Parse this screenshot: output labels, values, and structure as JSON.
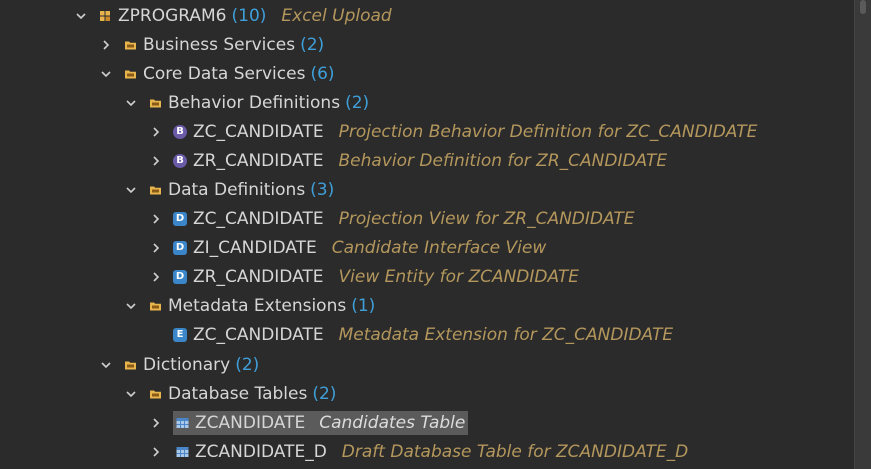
{
  "tree": {
    "rows": [
      {
        "name": "ZPROGRAM6",
        "count": "(10)",
        "desc": "Excel Upload",
        "icon": "package-icon",
        "expanded": true
      },
      {
        "name": "Business Services",
        "count": "(2)",
        "desc": "",
        "icon": "folder-icon",
        "expanded": false
      },
      {
        "name": "Core Data Services",
        "count": "(6)",
        "desc": "",
        "icon": "folder-icon",
        "expanded": true
      },
      {
        "name": "Behavior Definitions",
        "count": "(2)",
        "desc": "",
        "icon": "folder-icon",
        "expanded": true
      },
      {
        "name": "ZC_CANDIDATE",
        "count": "",
        "desc": "Projection Behavior Definition for ZC_CANDIDATE",
        "icon": "behavior-definition-icon",
        "icon_letter": "B",
        "expanded": false
      },
      {
        "name": "ZR_CANDIDATE",
        "count": "",
        "desc": "Behavior Definition for ZR_CANDIDATE",
        "icon": "behavior-definition-icon",
        "icon_letter": "B",
        "expanded": false
      },
      {
        "name": "Data Definitions",
        "count": "(3)",
        "desc": "",
        "icon": "folder-icon",
        "expanded": true
      },
      {
        "name": "ZC_CANDIDATE",
        "count": "",
        "desc": "Projection View for ZR_CANDIDATE",
        "icon": "data-definition-icon",
        "icon_letter": "D",
        "expanded": false
      },
      {
        "name": "ZI_CANDIDATE",
        "count": "",
        "desc": "Candidate Interface View",
        "icon": "data-definition-icon",
        "icon_letter": "D",
        "expanded": false
      },
      {
        "name": "ZR_CANDIDATE",
        "count": "",
        "desc": "View Entity for ZCANDIDATE",
        "icon": "data-definition-icon",
        "icon_letter": "D",
        "expanded": false
      },
      {
        "name": "Metadata Extensions",
        "count": "(1)",
        "desc": "",
        "icon": "folder-icon",
        "expanded": true
      },
      {
        "name": "ZC_CANDIDATE",
        "count": "",
        "desc": "Metadata Extension for ZC_CANDIDATE",
        "icon": "metadata-extension-icon",
        "icon_letter": "E",
        "expanded": null
      },
      {
        "name": "Dictionary",
        "count": "(2)",
        "desc": "",
        "icon": "folder-icon",
        "expanded": true
      },
      {
        "name": "Database Tables",
        "count": "(2)",
        "desc": "",
        "icon": "folder-icon",
        "expanded": true
      },
      {
        "name": "ZCANDIDATE",
        "count": "",
        "desc": "Candidates Table",
        "icon": "database-table-icon",
        "expanded": false,
        "selected": true
      },
      {
        "name": "ZCANDIDATE_D",
        "count": "",
        "desc": "Draft Database Table for ZCANDIDATE_D",
        "icon": "database-table-icon",
        "expanded": false
      }
    ]
  },
  "colors": {
    "background": "#2b2b2b",
    "name": "#d6d6d6",
    "count": "#3f9fd9",
    "description": "#b4975c",
    "selection": "#5b5b5b",
    "folder": "#e8b44c",
    "behavior_icon": "#6a5aa8",
    "data_icon": "#3a86c8",
    "extension_icon": "#3a86c8",
    "table_icon": "#a9c8e8"
  }
}
